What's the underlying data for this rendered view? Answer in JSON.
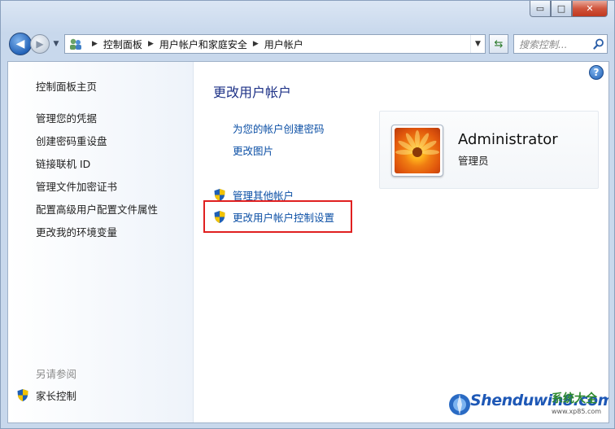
{
  "window": {
    "caption": {
      "minimize": "▭",
      "maximize": "□",
      "close": "✕"
    }
  },
  "nav": {
    "breadcrumbs": [
      "控制面板",
      "用户帐户和家庭安全",
      "用户帐户"
    ],
    "search_placeholder": "搜索控制..."
  },
  "sidebar": {
    "items": [
      {
        "label": "控制面板主页"
      },
      {
        "label": "管理您的凭据"
      },
      {
        "label": "创建密码重设盘"
      },
      {
        "label": "链接联机 ID"
      },
      {
        "label": "管理文件加密证书"
      },
      {
        "label": "配置高级用户配置文件属性"
      },
      {
        "label": "更改我的环境变量"
      }
    ],
    "see_also_label": "另请参阅",
    "parental_controls": "家长控制"
  },
  "main": {
    "title": "更改用户帐户",
    "links": [
      {
        "label": "为您的帐户创建密码"
      },
      {
        "label": "更改图片"
      }
    ],
    "admin_links": [
      {
        "label": "管理其他帐户"
      },
      {
        "label": "更改用户帐户控制设置"
      }
    ]
  },
  "account": {
    "name": "Administrator",
    "role": "管理员"
  },
  "help_icon": "?",
  "watermark": {
    "text": "Shenduwin8.com",
    "cn": "系统大全",
    "url": "www.xp85.com"
  },
  "colors": {
    "link": "#0b4fa5",
    "title": "#1e3287",
    "highlight": "#e02020"
  }
}
